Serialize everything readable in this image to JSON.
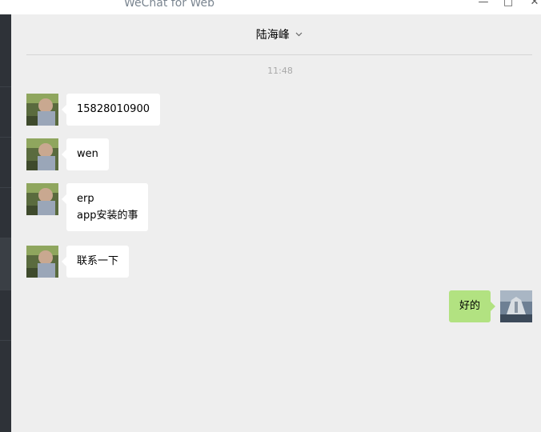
{
  "window": {
    "app_title": "WeChat for Web",
    "minimize": "—",
    "maximize": "□",
    "close": "✕"
  },
  "chat": {
    "contact_name": "陆海峰",
    "time_divider": "11:48"
  },
  "messages": [
    {
      "from": "contact",
      "lines": [
        "15828010900"
      ]
    },
    {
      "from": "contact",
      "lines": [
        "wen"
      ]
    },
    {
      "from": "contact",
      "lines": [
        "erp",
        "app安装的事"
      ]
    },
    {
      "from": "contact",
      "lines": [
        "联系一下"
      ]
    },
    {
      "from": "me",
      "lines": [
        "好的"
      ]
    }
  ]
}
